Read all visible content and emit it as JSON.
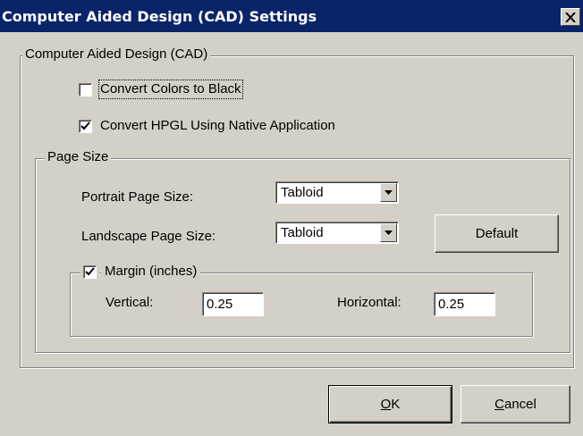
{
  "window": {
    "title": "Computer Aided Design (CAD) Settings"
  },
  "cad_group": {
    "legend": "Computer Aided Design (CAD)",
    "convert_colors": {
      "label": "Convert Colors to Black",
      "checked": false
    },
    "convert_hpgl": {
      "label": "Convert HPGL Using Native Application",
      "checked": true
    }
  },
  "page_size": {
    "legend": "Page Size",
    "portrait_label": "Portrait Page Size:",
    "portrait_value": "Tabloid",
    "landscape_label": "Landscape Page Size:",
    "landscape_value": "Tabloid",
    "default_button": "Default",
    "margin": {
      "label": "Margin (inches)",
      "checked": true,
      "vertical_label": "Vertical:",
      "vertical_value": "0.25",
      "horizontal_label": "Horizontal:",
      "horizontal_value": "0.25"
    }
  },
  "buttons": {
    "ok_mnemonic": "O",
    "ok_rest": "K",
    "cancel_mnemonic": "C",
    "cancel_rest": "ancel"
  },
  "icons": {
    "close": "close-icon",
    "check": "checkmark-icon",
    "dropdown": "chevron-down-icon"
  }
}
